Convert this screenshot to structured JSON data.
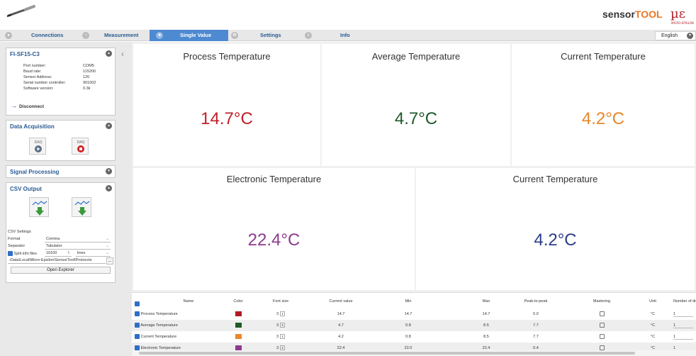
{
  "brand": {
    "part1": "sensor",
    "part2": "TOOL",
    "logo": "µε",
    "logo_sub": "MICRO-EPSILON"
  },
  "tabs": [
    {
      "label": "Connections",
      "icon": "plug-icon"
    },
    {
      "label": "Measurement",
      "icon": "gauge-icon"
    },
    {
      "label": "Single Value",
      "icon": "single-value-icon",
      "active": true
    },
    {
      "label": "Settings",
      "icon": "settings-icon"
    },
    {
      "label": "Info",
      "icon": "info-icon"
    }
  ],
  "language": "English",
  "device": {
    "title": "FI-SF15-C3",
    "props": [
      {
        "label": "Port number:",
        "value": "COM5"
      },
      {
        "label": "Baud rate:",
        "value": "115200"
      },
      {
        "label": "Sensor Address:",
        "value": "126"
      },
      {
        "label": "Serial number controller:",
        "value": "901002"
      },
      {
        "label": "Software version:",
        "value": "0.3k"
      }
    ],
    "disconnect": "Disconnect"
  },
  "data_acq": {
    "title": "Data Acquisition",
    "start_label": "DAQ",
    "stop_label": "DAQ"
  },
  "signal": {
    "title": "Signal Processing"
  },
  "csv": {
    "title": "CSV Output",
    "settings_label": "CSV Settings",
    "format_label": "Format",
    "format_value": "Comma",
    "separator_label": "Separator",
    "separator_value": "Tabulator",
    "split_label": "Split info files",
    "split_count": "10100",
    "split_unit": "lines",
    "path": "›Data\\Local\\Micro-Epsilon\\SensorTool\\Protocols",
    "browse": "...",
    "open_explorer": "Open Explorer"
  },
  "tiles": [
    {
      "title": "Process Temperature",
      "value": "14.7°C",
      "color": "#c0202a"
    },
    {
      "title": "Average Temperature",
      "value": "4.7°C",
      "color": "#1f5a2a"
    },
    {
      "title": "Current Temperature",
      "value": "4.2°C",
      "color": "#e8872a"
    },
    {
      "title": "Electronic Temperature",
      "value": "22.4°C",
      "color": "#8e3a8e"
    },
    {
      "title": "Current Temperature",
      "value": "4.2°C",
      "color": "#2b3d8a"
    }
  ],
  "grid": {
    "headers": [
      "Name",
      "Color",
      "Font size",
      "Current value",
      "Min",
      "Max",
      "Peak-to-peak",
      "Mastering",
      "Unit",
      "Number of dig"
    ],
    "rows": [
      {
        "name": "Process Temperature",
        "color": "#b01a24",
        "font": "3",
        "current": "14.7",
        "min": "14.7",
        "max": "14.7",
        "p2p": "0.0",
        "unit": "°C",
        "digits": "1"
      },
      {
        "name": "Average Temperature",
        "color": "#1f5a2a",
        "font": "3",
        "current": "4.7",
        "min": "0.8",
        "max": "8.5",
        "p2p": "7.7",
        "unit": "°C",
        "digits": "1"
      },
      {
        "name": "Current Temperature",
        "color": "#e8872a",
        "font": "3",
        "current": "4.2",
        "min": "0.8",
        "max": "8.5",
        "p2p": "7.7",
        "unit": "°C",
        "digits": "1"
      },
      {
        "name": "Electronic Temperature",
        "color": "#8e3a8e",
        "font": "3",
        "current": "22.4",
        "min": "22.0",
        "max": "22.4",
        "p2p": "0.4",
        "unit": "°C",
        "digits": "1"
      }
    ]
  }
}
